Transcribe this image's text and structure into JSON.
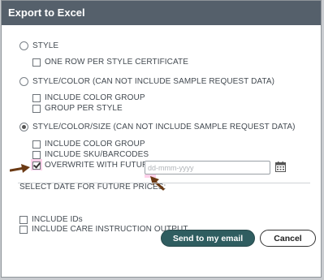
{
  "dialog": {
    "title": "Export to Excel"
  },
  "options": {
    "style": {
      "label": "STYLE",
      "selected": false
    },
    "style_one_row": {
      "label": "ONE ROW PER STYLE CERTIFICATE",
      "checked": false
    },
    "style_color": {
      "label": "STYLE/COLOR (CAN NOT INCLUDE SAMPLE REQUEST DATA)",
      "selected": false
    },
    "sc_include_color_group": {
      "label": "INCLUDE COLOR GROUP",
      "checked": false
    },
    "sc_group_per_style": {
      "label": "GROUP PER STYLE",
      "checked": false
    },
    "style_color_size": {
      "label": "STYLE/COLOR/SIZE (CAN NOT INCLUDE SAMPLE REQUEST DATA)",
      "selected": true
    },
    "scs_include_color_group": {
      "label": "INCLUDE COLOR GROUP",
      "checked": false
    },
    "scs_include_sku": {
      "label": "INCLUDE SKU/BARCODES",
      "checked": false
    },
    "scs_overwrite_future": {
      "label": "OVERWRITE WITH FUTURE PRICES",
      "checked": true
    }
  },
  "future_prices": {
    "label": "SELECT DATE FOR FUTURE PRICES:",
    "placeholder": "dd-mmm-yyyy",
    "value": ""
  },
  "extras": {
    "include_ids": {
      "label": "INCLUDE IDs",
      "checked": false
    },
    "include_care": {
      "label": "INCLUDE CARE INSTRUCTION OUTPUT",
      "checked": false
    }
  },
  "buttons": {
    "send_email": "Send to my email",
    "cancel": "Cancel"
  },
  "colors": {
    "titlebar": "#55606b",
    "primary_button": "#2f5d60",
    "annotation_arrow": "#6b3a14"
  },
  "icons": {
    "calendar": "calendar-icon",
    "annotation": "arrow-annotation-icon"
  }
}
